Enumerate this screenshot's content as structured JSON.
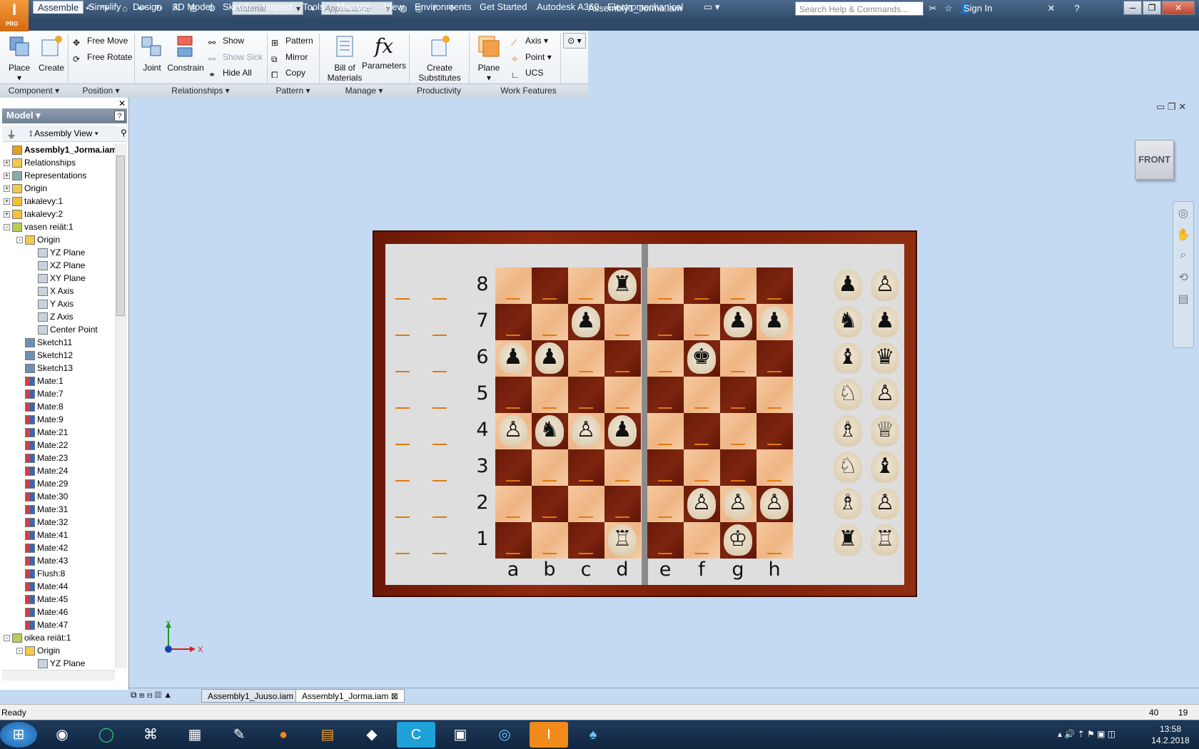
{
  "app": {
    "logo_text": "I",
    "logo_sub": "PRO",
    "doc_title": "Assembly1_Jorma.iam",
    "material_placeholder": "Material",
    "appearance_placeholder": "Appearance",
    "search_placeholder": "Search Help & Commands...",
    "sign_in": "Sign In"
  },
  "menu": {
    "tabs": [
      "Assemble",
      "Simplify",
      "Design",
      "3D Model",
      "Sketch",
      "Inspect",
      "Tools",
      "Manage",
      "View",
      "Environments",
      "Get Started",
      "Autodesk A360",
      "Electromechanical"
    ],
    "active": "Assemble"
  },
  "ribbon": {
    "place": "Place",
    "create": "Create",
    "free_move": "Free Move",
    "free_rotate": "Free Rotate",
    "joint": "Joint",
    "constrain": "Constrain",
    "show": "Show",
    "show_sick": "Show Sick",
    "hide_all": "Hide All",
    "pattern": "Pattern",
    "mirror": "Mirror",
    "copy": "Copy",
    "bom_line1": "Bill of",
    "bom_line2": "Materials",
    "parameters": "Parameters",
    "create_subs_line1": "Create",
    "create_subs_line2": "Substitutes",
    "plane": "Plane",
    "axis": "Axis",
    "point": "Point",
    "ucs": "UCS",
    "panels": [
      "Component",
      "Position",
      "Relationships",
      "Pattern",
      "Manage",
      "Productivity",
      "Work Features"
    ]
  },
  "browser": {
    "title": "Model",
    "view_label": "Assembly View",
    "nodes": [
      {
        "label": "Assembly1_Jorma.iam",
        "level": 0,
        "exp": "",
        "icon": "assembly",
        "bold": true
      },
      {
        "label": "Relationships",
        "level": 0,
        "exp": "+",
        "icon": "folder"
      },
      {
        "label": "Representations",
        "level": 0,
        "exp": "+",
        "icon": "rep"
      },
      {
        "label": "Origin",
        "level": 0,
        "exp": "+",
        "icon": "folder"
      },
      {
        "label": "takalevy:1",
        "level": 0,
        "exp": "+",
        "icon": "part"
      },
      {
        "label": "takalevy:2",
        "level": 0,
        "exp": "+",
        "icon": "part"
      },
      {
        "label": "vasen reiät:1",
        "level": 0,
        "exp": "-",
        "icon": "subasm"
      },
      {
        "label": "Origin",
        "level": 1,
        "exp": "-",
        "icon": "folder"
      },
      {
        "label": "YZ Plane",
        "level": 2,
        "exp": "",
        "icon": "plane"
      },
      {
        "label": "XZ Plane",
        "level": 2,
        "exp": "",
        "icon": "plane"
      },
      {
        "label": "XY Plane",
        "level": 2,
        "exp": "",
        "icon": "plane"
      },
      {
        "label": "X Axis",
        "level": 2,
        "exp": "",
        "icon": "axis"
      },
      {
        "label": "Y Axis",
        "level": 2,
        "exp": "",
        "icon": "axis"
      },
      {
        "label": "Z Axis",
        "level": 2,
        "exp": "",
        "icon": "axis"
      },
      {
        "label": "Center Point",
        "level": 2,
        "exp": "",
        "icon": "point"
      },
      {
        "label": "Sketch11",
        "level": 1,
        "exp": "",
        "icon": "sketch"
      },
      {
        "label": "Sketch12",
        "level": 1,
        "exp": "",
        "icon": "sketch"
      },
      {
        "label": "Sketch13",
        "level": 1,
        "exp": "",
        "icon": "sketch"
      },
      {
        "label": "Mate:1",
        "level": 1,
        "exp": "",
        "icon": "mate"
      },
      {
        "label": "Mate:7",
        "level": 1,
        "exp": "",
        "icon": "mate"
      },
      {
        "label": "Mate:8",
        "level": 1,
        "exp": "",
        "icon": "mate"
      },
      {
        "label": "Mate:9",
        "level": 1,
        "exp": "",
        "icon": "mate"
      },
      {
        "label": "Mate:21",
        "level": 1,
        "exp": "",
        "icon": "mate"
      },
      {
        "label": "Mate:22",
        "level": 1,
        "exp": "",
        "icon": "mate"
      },
      {
        "label": "Mate:23",
        "level": 1,
        "exp": "",
        "icon": "mate"
      },
      {
        "label": "Mate:24",
        "level": 1,
        "exp": "",
        "icon": "mate"
      },
      {
        "label": "Mate:29",
        "level": 1,
        "exp": "",
        "icon": "mate"
      },
      {
        "label": "Mate:30",
        "level": 1,
        "exp": "",
        "icon": "mate"
      },
      {
        "label": "Mate:31",
        "level": 1,
        "exp": "",
        "icon": "mate"
      },
      {
        "label": "Mate:32",
        "level": 1,
        "exp": "",
        "icon": "mate"
      },
      {
        "label": "Mate:41",
        "level": 1,
        "exp": "",
        "icon": "mate"
      },
      {
        "label": "Mate:42",
        "level": 1,
        "exp": "",
        "icon": "mate"
      },
      {
        "label": "Mate:43",
        "level": 1,
        "exp": "",
        "icon": "mate"
      },
      {
        "label": "Flush:8",
        "level": 1,
        "exp": "",
        "icon": "flush"
      },
      {
        "label": "Mate:44",
        "level": 1,
        "exp": "",
        "icon": "mate"
      },
      {
        "label": "Mate:45",
        "level": 1,
        "exp": "",
        "icon": "mate"
      },
      {
        "label": "Mate:46",
        "level": 1,
        "exp": "",
        "icon": "mate"
      },
      {
        "label": "Mate:47",
        "level": 1,
        "exp": "",
        "icon": "mate"
      },
      {
        "label": "oikea reiät:1",
        "level": 0,
        "exp": "-",
        "icon": "subasm"
      },
      {
        "label": "Origin",
        "level": 1,
        "exp": "-",
        "icon": "folder"
      },
      {
        "label": "YZ Plane",
        "level": 2,
        "exp": "",
        "icon": "plane"
      }
    ]
  },
  "viewcube": "FRONT",
  "board": {
    "ranks": [
      "8",
      "7",
      "6",
      "5",
      "4",
      "3",
      "2",
      "1"
    ],
    "files": [
      "a",
      "b",
      "c",
      "d",
      "e",
      "f",
      "g",
      "h"
    ],
    "pieces": [
      {
        "sq": "d8",
        "glyph": "♜"
      },
      {
        "sq": "c7",
        "glyph": "♟"
      },
      {
        "sq": "g7",
        "glyph": "♟"
      },
      {
        "sq": "h7",
        "glyph": "♟"
      },
      {
        "sq": "a6",
        "glyph": "♟"
      },
      {
        "sq": "b6",
        "glyph": "♟"
      },
      {
        "sq": "f6",
        "glyph": "♚"
      },
      {
        "sq": "a4",
        "glyph": "♙"
      },
      {
        "sq": "b4",
        "glyph": "♞"
      },
      {
        "sq": "c4",
        "glyph": "♙"
      },
      {
        "sq": "d4",
        "glyph": "♟"
      },
      {
        "sq": "f2",
        "glyph": "♙"
      },
      {
        "sq": "g2",
        "glyph": "♙"
      },
      {
        "sq": "h2",
        "glyph": "♙"
      },
      {
        "sq": "d1",
        "glyph": "♖"
      },
      {
        "sq": "g1",
        "glyph": "♔"
      }
    ],
    "captured": [
      [
        "♟",
        "♙"
      ],
      [
        "♞",
        "♟"
      ],
      [
        "♝",
        "♛"
      ],
      [
        "♘",
        "♙"
      ],
      [
        "♗",
        "♕"
      ],
      [
        "♘",
        "♝"
      ],
      [
        "♗",
        "♙"
      ],
      [
        "♜",
        "♖"
      ]
    ]
  },
  "triad": {
    "x": "X",
    "y": "Y"
  },
  "doc_tabs": [
    "Assembly1_Juuso.iam",
    "Assembly1_Jorma.iam"
  ],
  "status": {
    "text": "Ready",
    "n1": "40",
    "n2": "19"
  },
  "taskbar": {
    "time": "13:58",
    "date": "14.2.2018"
  }
}
